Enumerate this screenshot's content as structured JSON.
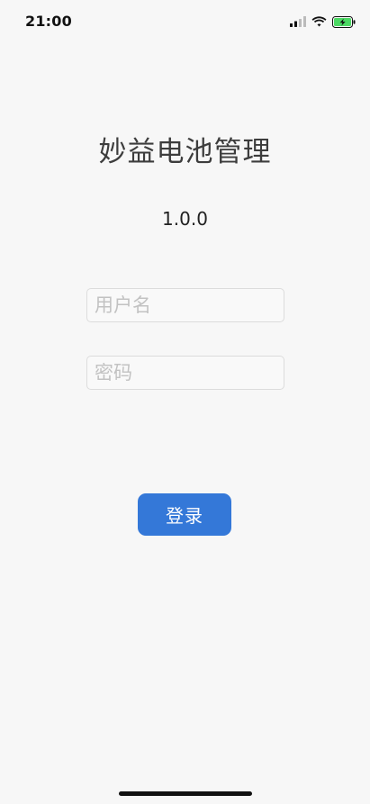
{
  "status_bar": {
    "time": "21:00",
    "icons": [
      "cellular-signal-icon",
      "wifi-icon",
      "battery-charging-icon"
    ],
    "battery_color": "#4cd964"
  },
  "app": {
    "title": "妙益电池管理",
    "version": "1.0.0"
  },
  "login_form": {
    "username": {
      "value": "",
      "placeholder": "用户名"
    },
    "password": {
      "value": "",
      "placeholder": "密码"
    },
    "submit_label": "登录"
  },
  "colors": {
    "background": "#f7f7f7",
    "accent": "#3478d8"
  }
}
